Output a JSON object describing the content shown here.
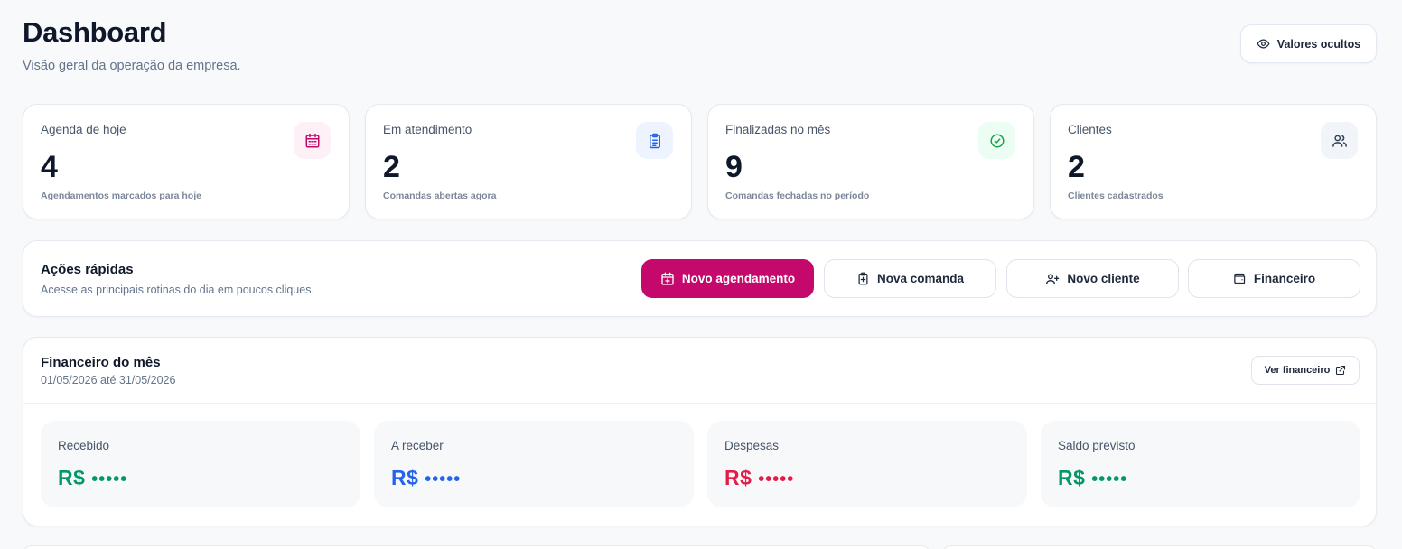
{
  "header": {
    "title": "Dashboard",
    "subtitle": "Visão geral da operação da empresa.",
    "hide_values_label": "Valores ocultos"
  },
  "stats": [
    {
      "label": "Agenda de hoje",
      "value": "4",
      "description": "Agendamentos marcados para hoje",
      "icon": "calendar-icon",
      "icon_color": "#c4086c",
      "icon_bg": "#fdf0f6"
    },
    {
      "label": "Em atendimento",
      "value": "2",
      "description": "Comandas abertas agora",
      "icon": "clipboard-icon",
      "icon_color": "#2563eb",
      "icon_bg": "#eef4ff"
    },
    {
      "label": "Finalizadas no mês",
      "value": "9",
      "description": "Comandas fechadas no período",
      "icon": "check-circle-icon",
      "icon_color": "#16a34a",
      "icon_bg": "#ecfdf3"
    },
    {
      "label": "Clientes",
      "value": "2",
      "description": "Clientes cadastrados",
      "icon": "users-icon",
      "icon_color": "#334155",
      "icon_bg": "#f1f4f8"
    }
  ],
  "quick_actions": {
    "title": "Ações rápidas",
    "subtitle": "Acesse as principais rotinas do dia em poucos cliques.",
    "buttons": [
      {
        "label": "Novo agendamento",
        "icon": "calendar-plus-icon"
      },
      {
        "label": "Nova comanda",
        "icon": "clipboard-plus-icon"
      },
      {
        "label": "Novo cliente",
        "icon": "user-plus-icon"
      },
      {
        "label": "Financeiro",
        "icon": "wallet-icon"
      }
    ],
    "primary_color": "#c4086c"
  },
  "financial": {
    "title": "Financeiro do mês",
    "period": "01/05/2026 até 31/05/2026",
    "link_label": "Ver financeiro",
    "cards": [
      {
        "label": "Recebido",
        "currency": "R$",
        "masked_value": "•••••",
        "color": "#059669"
      },
      {
        "label": "A receber",
        "currency": "R$",
        "masked_value": "•••••",
        "color": "#2563eb"
      },
      {
        "label": "Despesas",
        "currency": "R$",
        "masked_value": "•••••",
        "color": "#e11d48"
      },
      {
        "label": "Saldo previsto",
        "currency": "R$",
        "masked_value": "•••••",
        "color": "#059669"
      }
    ]
  }
}
